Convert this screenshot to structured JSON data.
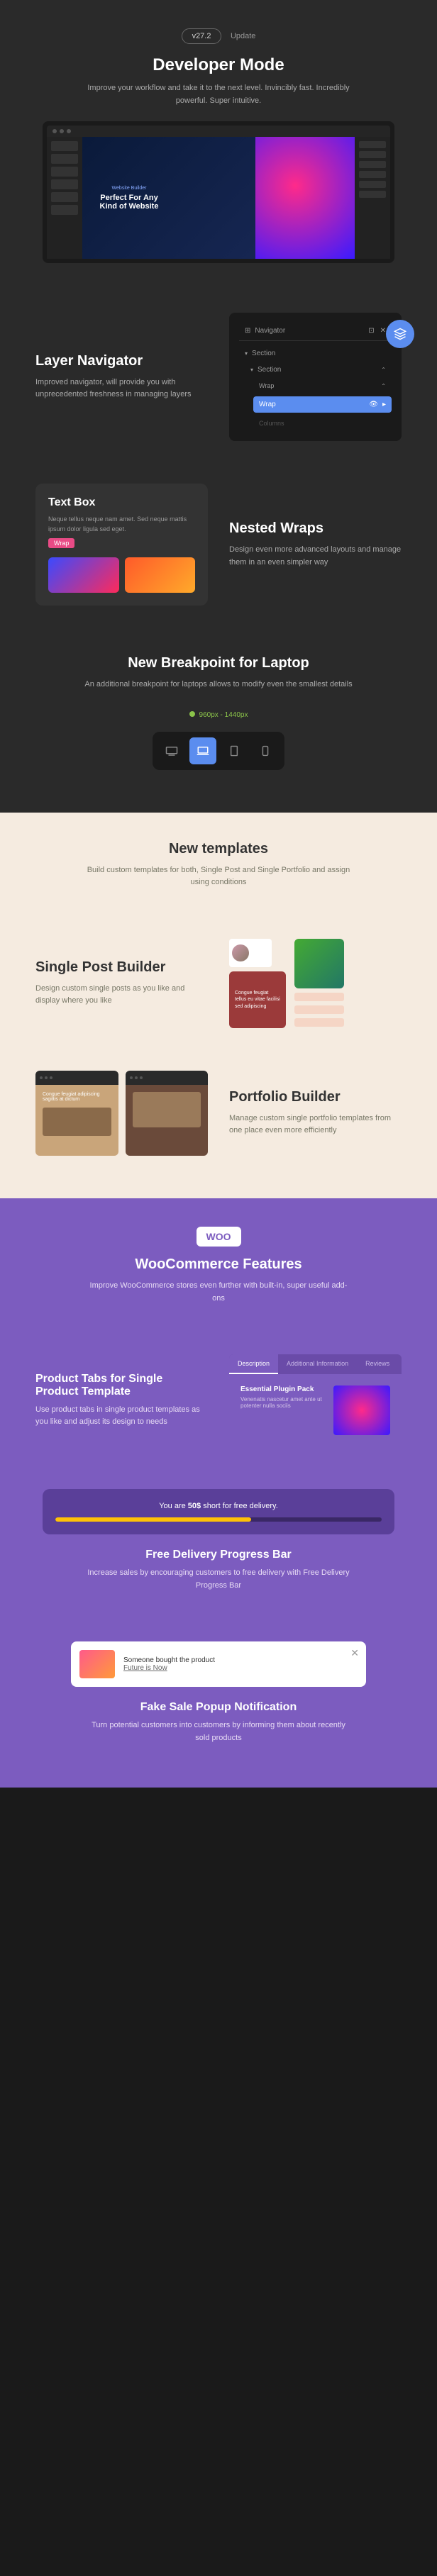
{
  "hero": {
    "version": "v27.2",
    "update": "Update",
    "title": "Developer Mode",
    "sub": "Improve your workflow and take it to the next level. Invincibly fast. Incredibly powerful. Super intuitive.",
    "mockupSmall": "Website Builder",
    "mockupTitle": "Perfect For Any Kind of Website"
  },
  "nav": {
    "title": "Layer Navigator",
    "sub": "Improved navigator, will provide you with unprecedented freshness in managing layers",
    "panel": {
      "title": "Navigator",
      "items": [
        "Section",
        "Section",
        "Wrap",
        "Wrap",
        "Columns"
      ]
    }
  },
  "textbox": {
    "title": "Text Box",
    "lorem": "Neque tellus neque nam amet. Sed neque mattis ipsum dolor ligula sed eget.",
    "badge": "Wrap"
  },
  "nested": {
    "title": "Nested Wraps",
    "sub": "Design even more advanced layouts and manage them in an even simpler way"
  },
  "breakpoint": {
    "title": "New Breakpoint for Laptop",
    "sub": "An additional breakpoint for laptops allows to modify even the smallest details",
    "range": "960px - 1440px"
  },
  "templates": {
    "title": "New templates",
    "sub": "Build custom templates for both, Single Post and Single Portfolio and assign using conditions"
  },
  "singlePost": {
    "title": "Single Post Builder",
    "sub": "Design custom single posts as you like and display where you like",
    "cardText": "Congue feugiat tellus eu vitae facilisi sed adipiscing"
  },
  "portfolio": {
    "title": "Portfolio Builder",
    "sub": "Manage custom single portfolio templates from one place even more efficiently",
    "cardText": "Congue feugiat adipiscing sagittis at dictum"
  },
  "woo": {
    "logo": "WOO",
    "title": "WooCommerce Features",
    "sub": "Improve WooCommerce stores even further with built-in, super useful add-ons"
  },
  "productTabs": {
    "title": "Product Tabs for Single Product Template",
    "sub": "Use product tabs in single product templates as you like and adjust its design to needs",
    "tabs": [
      "Description",
      "Additional Information",
      "Reviews"
    ],
    "contentTitle": "Essential Plugin Pack",
    "contentText": "Venenatis nascetur amet ante ut potenter nulla sociis"
  },
  "delivery": {
    "msgPre": "You are ",
    "msgAmount": "50$",
    "msgPost": " short for free delivery.",
    "title": "Free Delivery Progress Bar",
    "sub": "Increase sales by encouraging customers to free delivery with Free Delivery Progress Bar"
  },
  "popup": {
    "line1": "Someone bought the product",
    "line2": "Future is Now",
    "title": "Fake Sale Popup Notification",
    "sub": "Turn potential customers into customers by informing them about recently sold products"
  }
}
